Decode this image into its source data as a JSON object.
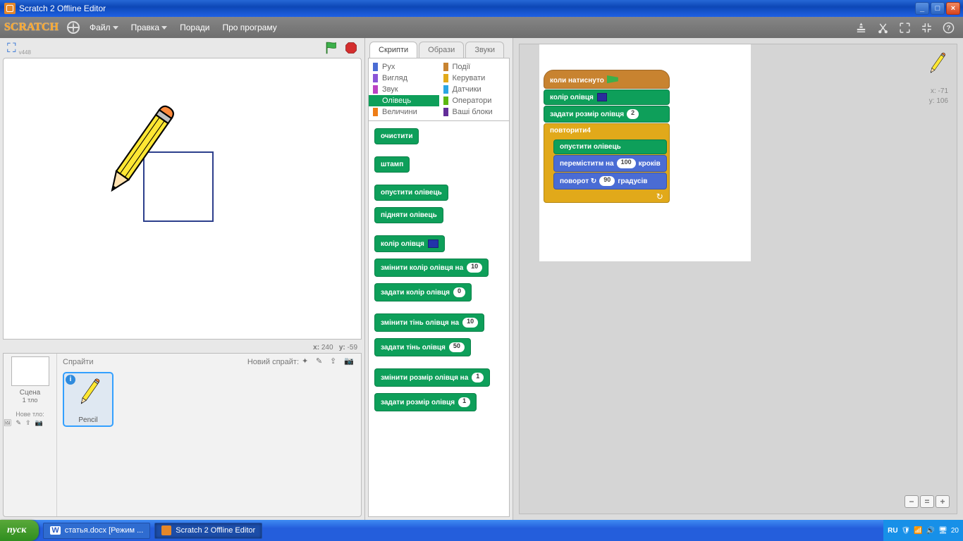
{
  "xp": {
    "title": "Scratch 2 Offline Editor",
    "start": "пуск",
    "task_word": "статья.docx  [Режим ...",
    "task_scratch": "Scratch 2 Offline Editor",
    "tray_lang": "RU",
    "tray_time": "20"
  },
  "menu": {
    "logo": "SCRATCH",
    "file": "Файл",
    "edit": "Правка",
    "tips": "Поради",
    "about": "Про програму"
  },
  "stage": {
    "version": "v448",
    "coord_x_lbl": "x:",
    "coord_x": "240",
    "coord_y_lbl": "y:",
    "coord_y": "-59",
    "scene_lbl": "Сцена",
    "scene_sub": "1 тло",
    "new_backdrop": "Нове тло:"
  },
  "sprites": {
    "header": "Спрайти",
    "new_sprite_lbl": "Новий спрайт:",
    "pencil_name": "Pencil"
  },
  "tabs": {
    "scripts": "Скрипти",
    "costumes": "Образи",
    "sounds": "Звуки"
  },
  "cats": {
    "motion": "Рух",
    "looks": "Вигляд",
    "sound": "Звук",
    "pen": "Олівець",
    "data": "Величини",
    "events": "Події",
    "control": "Керувати",
    "sensing": "Датчики",
    "ops": "Оператори",
    "more": "Ваші блоки"
  },
  "palette": {
    "clear": "очистити",
    "stamp": "штамп",
    "pendown": "опустити олівець",
    "penup": "підняти олівець",
    "pencolor": "колір олівця",
    "changecolor": "змінити колір олівця на",
    "changecolor_v": "10",
    "setcolor": "задати колір олівця",
    "setcolor_v": "0",
    "changeshade": "змінити тінь олівця на",
    "changeshade_v": "10",
    "setshade": "задати тінь олівця",
    "setshade_v": "50",
    "changesize": "змінити розмір олівця на",
    "changesize_v": "1",
    "setsize": "задати розмір олівця",
    "setsize_v": "1"
  },
  "script": {
    "hat": "коли натиснуто",
    "pencolor": "колір олівця",
    "setsize": "задати розмір олівця",
    "setsize_v": "2",
    "repeat": "повторити",
    "repeat_v": "4",
    "pendown": "опустити олівець",
    "move_a": "переміститм на",
    "move_v": "100",
    "move_b": "кроків",
    "turn_a": "поворот ↻",
    "turn_v": "90",
    "turn_b": "градусів"
  },
  "canvas": {
    "x_lbl": "x:",
    "x": "-71",
    "y_lbl": "y:",
    "y": "106"
  }
}
